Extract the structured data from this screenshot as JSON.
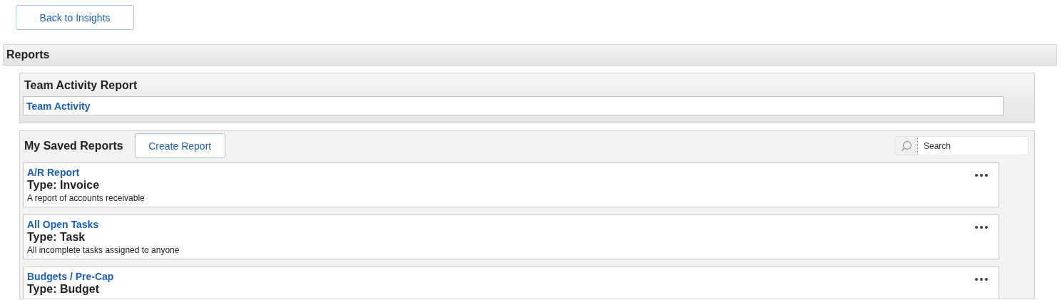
{
  "back_button": {
    "label": "Back to Insights"
  },
  "section": {
    "title": "Reports"
  },
  "team_panel": {
    "title": "Team Activity Report",
    "link": "Team Activity"
  },
  "saved_panel": {
    "title": "My Saved Reports",
    "create_button": "Create Report",
    "search": {
      "placeholder": "Search"
    },
    "reports": [
      {
        "name": "A/R Report",
        "type": "Type: Invoice",
        "description": "A report of accounts receivable"
      },
      {
        "name": "All Open Tasks",
        "type": "Type: Task",
        "description": "All incomplete tasks assigned to anyone"
      },
      {
        "name": "Budgets / Pre-Cap",
        "type": "Type: Budget"
      }
    ]
  }
}
